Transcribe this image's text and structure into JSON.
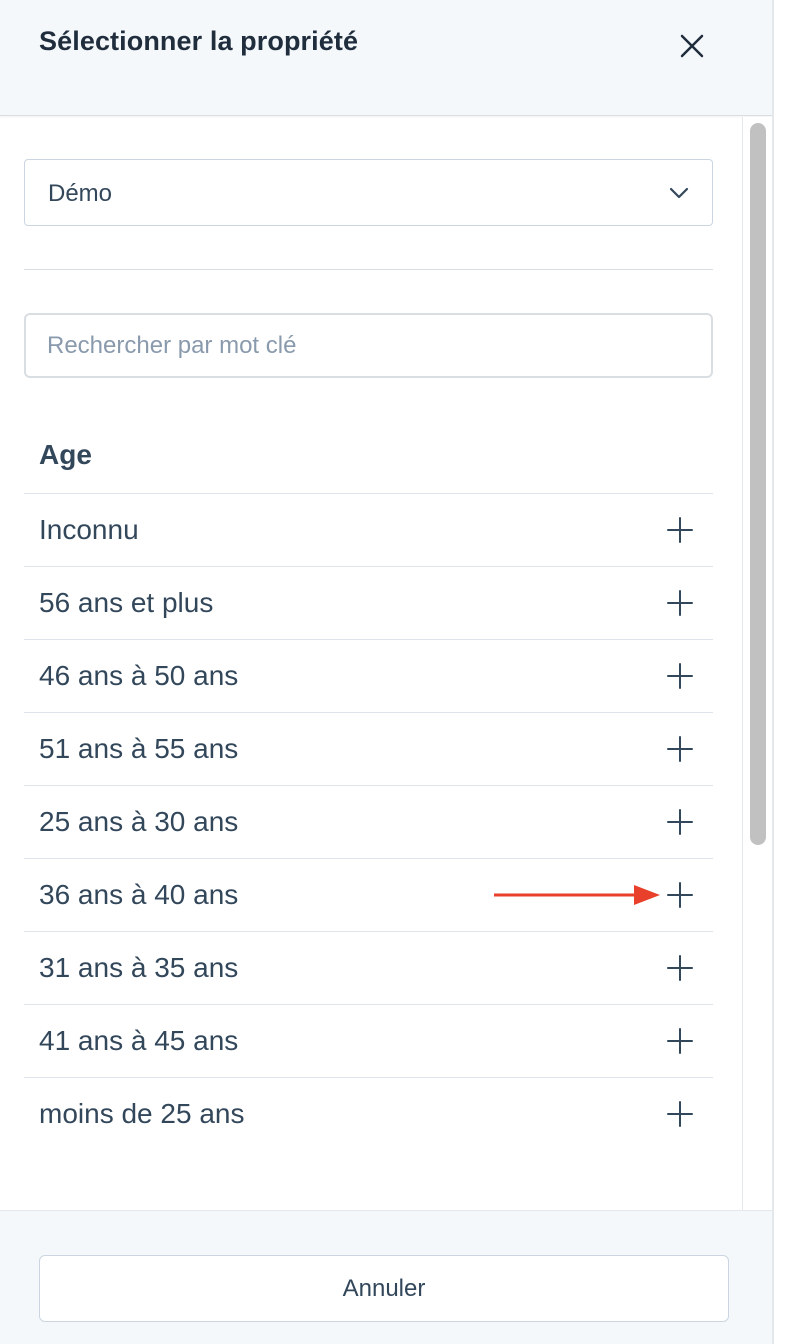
{
  "header": {
    "title": "Sélectionner la propriété",
    "close_icon": "close-icon"
  },
  "filter": {
    "selected": "Démo"
  },
  "search": {
    "placeholder": "Rechercher par mot clé",
    "value": ""
  },
  "group": {
    "title": "Age",
    "items": [
      {
        "label": "Inconnu"
      },
      {
        "label": "56 ans et plus"
      },
      {
        "label": "46 ans à 50 ans"
      },
      {
        "label": "51 ans à 55 ans"
      },
      {
        "label": "25 ans à 30 ans"
      },
      {
        "label": "36 ans à 40 ans"
      },
      {
        "label": "31 ans à 35 ans"
      },
      {
        "label": "41 ans à 45 ans"
      },
      {
        "label": "moins de 25 ans"
      }
    ]
  },
  "footer": {
    "cancel_label": "Annuler"
  },
  "colors": {
    "text": "#33475b",
    "title": "#1f2d3d",
    "header_bg": "#f5f8fa",
    "annotation_arrow": "#e8402a"
  }
}
